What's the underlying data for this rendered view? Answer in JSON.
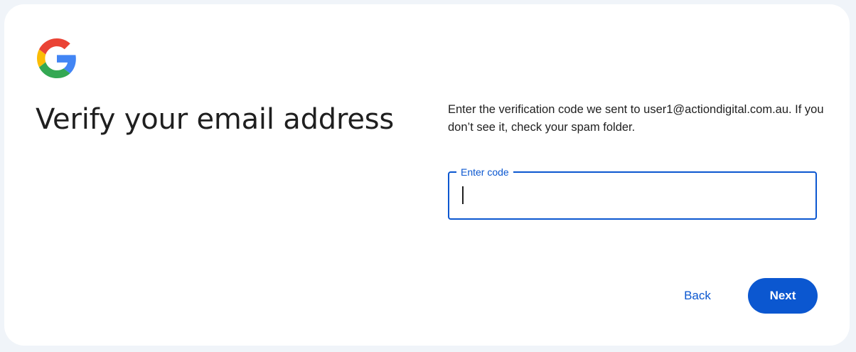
{
  "brand": {
    "logo_icon": "google-g-logo-icon",
    "colors": {
      "blue": "#4285F4",
      "red": "#EA4335",
      "yellow": "#FBBC05",
      "green": "#34A853"
    }
  },
  "heading": {
    "title": "Verify your email address"
  },
  "description": {
    "text": "Enter the verification code we sent to user1@actiondigital.com.au. If you don’t see it, check your spam folder."
  },
  "code_field": {
    "label": "Enter code",
    "value": ""
  },
  "actions": {
    "back_label": "Back",
    "next_label": "Next"
  },
  "theme": {
    "accent": "#0b57d0",
    "page_background": "#f0f4f9",
    "card_background": "#ffffff",
    "text": "#1f1f1f"
  }
}
